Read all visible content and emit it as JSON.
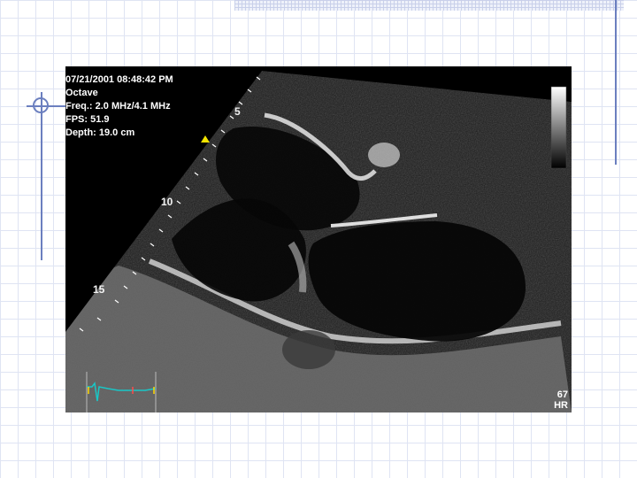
{
  "slide": {
    "echo_image": {
      "name": "parasternal-long-axis-echocardiogram",
      "overlay": {
        "datetime": "07/21/2001 08:48:42 PM",
        "mode": "Octave",
        "frequency": "Freq.: 2.0 MHz/4.1 MHz",
        "fps": "FPS: 51.9",
        "depth": "Depth: 19.0 cm"
      },
      "depth_markers": [
        "5",
        "10",
        "15"
      ],
      "heart_rate": {
        "value": "67",
        "unit": "HR"
      },
      "gray_scale_bar": {
        "top_color": "#ffffff",
        "bottom_color": "#000000"
      },
      "ecg_trace_color": "#19c7c7",
      "ecg_marker_color": "#ff4b4b",
      "focus_marker_color": "#f2e300"
    }
  },
  "colors": {
    "grid_line": "#dfe4f3",
    "rule": "#6b7fbf",
    "image_background": "#000000"
  }
}
